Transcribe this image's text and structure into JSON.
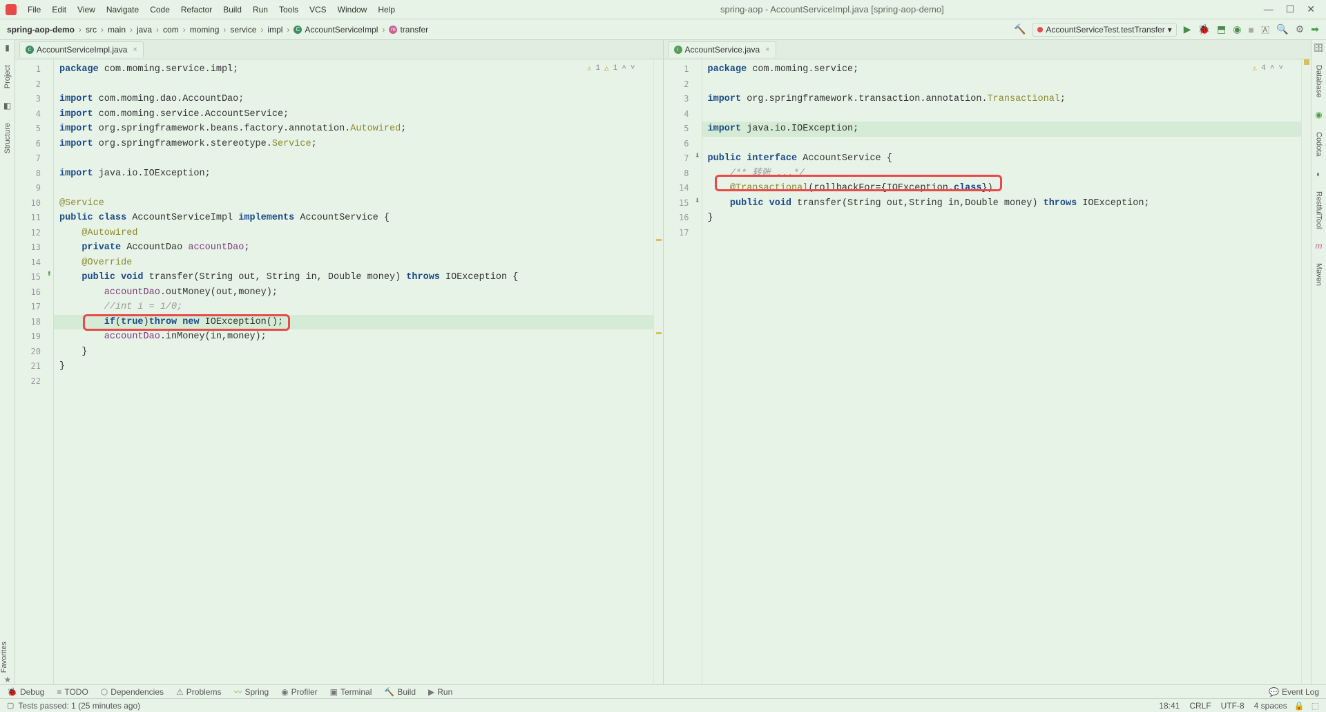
{
  "menu": {
    "file": "File",
    "edit": "Edit",
    "view": "View",
    "navigate": "Navigate",
    "code": "Code",
    "refactor": "Refactor",
    "build": "Build",
    "run": "Run",
    "tools": "Tools",
    "vcs": "VCS",
    "window": "Window",
    "help": "Help"
  },
  "window_title": "spring-aop - AccountServiceImpl.java [spring-aop-demo]",
  "breadcrumbs": [
    "spring-aop-demo",
    "src",
    "main",
    "java",
    "com",
    "moming",
    "service",
    "impl",
    "AccountServiceImpl",
    "transfer"
  ],
  "run_config": "AccountServiceTest.testTransfer",
  "left_tools": {
    "project": "Project",
    "structure": "Structure",
    "favorites": "Favorites"
  },
  "right_tools": {
    "database": "Database",
    "codota": "Codota",
    "restfultool": "RestfulTool",
    "maven": "Maven"
  },
  "left_tab": {
    "name": "AccountServiceImpl.java"
  },
  "right_tab": {
    "name": "AccountService.java"
  },
  "left_inspection": {
    "w1": "1",
    "w2": "1"
  },
  "right_inspection": {
    "w1": "4"
  },
  "left_code": {
    "l1a": "package",
    "l1b": " com.moming.service.impl;",
    "l3a": "import",
    "l3b": " com.moming.dao.AccountDao;",
    "l4a": "import",
    "l4b": " com.moming.service.AccountService;",
    "l5a": "import",
    "l5b": " org.springframework.beans.factory.annotation.",
    "l5c": "Autowired",
    "l5d": ";",
    "l6a": "import",
    "l6b": " org.springframework.stereotype.",
    "l6c": "Service",
    "l6d": ";",
    "l8a": "import",
    "l8b": " java.io.IOException;",
    "l10a": "@Service",
    "l11a": "public class",
    "l11b": " AccountServiceImpl ",
    "l11c": "implements",
    "l11d": " AccountService {",
    "l12a": "    @Autowired",
    "l13a": "    private",
    "l13b": " AccountDao ",
    "l13c": "accountDao",
    "l13d": ";",
    "l14a": "    @Override",
    "l15a": "    public void ",
    "l15b": "transfer",
    "l15c": "(String out, String in, Double money) ",
    "l15d": "throws",
    "l15e": " IOException {",
    "l16a": "        accountDao",
    "l16b": ".outMoney(out,money);",
    "l17a": "        //int i = 1/0;",
    "l18a": "        if",
    "l18b": "(",
    "l18c": "true",
    "l18d": ")",
    "l18e": "throw new",
    "l18f": " IOException();",
    "l19a": "        accountDao",
    "l19b": ".inMoney(in,money);",
    "l20a": "    }",
    "l21a": "}"
  },
  "right_code": {
    "l1a": "package",
    "l1b": " com.moming.service;",
    "l3a": "import",
    "l3b": " org.springframework.transaction.annotation.",
    "l3c": "Transactional",
    "l3d": ";",
    "l5a": "import",
    "l5b": " java.io.IOException;",
    "l7a": "public interface",
    "l7b": " AccountService {",
    "l8a": "    /** 转账 ...*/",
    "l14a": "    @Transactional",
    "l14b": "(rollbackFor={IOException.",
    "l14c": "class",
    "l14d": "})",
    "l15a": "    public void ",
    "l15b": "transfer",
    "l15c": "(String out,String in,Double money) ",
    "l15d": "throws",
    "l15e": " IOException;",
    "l16a": "}"
  },
  "right_gutter": [
    "1",
    "2",
    "3",
    "4",
    "5",
    "6",
    "7",
    "8",
    "14",
    "15",
    "16",
    "17"
  ],
  "bottom": {
    "debug": "Debug",
    "todo": "TODO",
    "deps": "Dependencies",
    "problems": "Problems",
    "spring": "Spring",
    "profiler": "Profiler",
    "terminal": "Terminal",
    "build": "Build",
    "run": "Run",
    "eventlog": "Event Log"
  },
  "status": {
    "msg": "Tests passed: 1 (25 minutes ago)",
    "pos": "18:41",
    "eol": "CRLF",
    "enc": "UTF-8",
    "indent": "4 spaces"
  }
}
